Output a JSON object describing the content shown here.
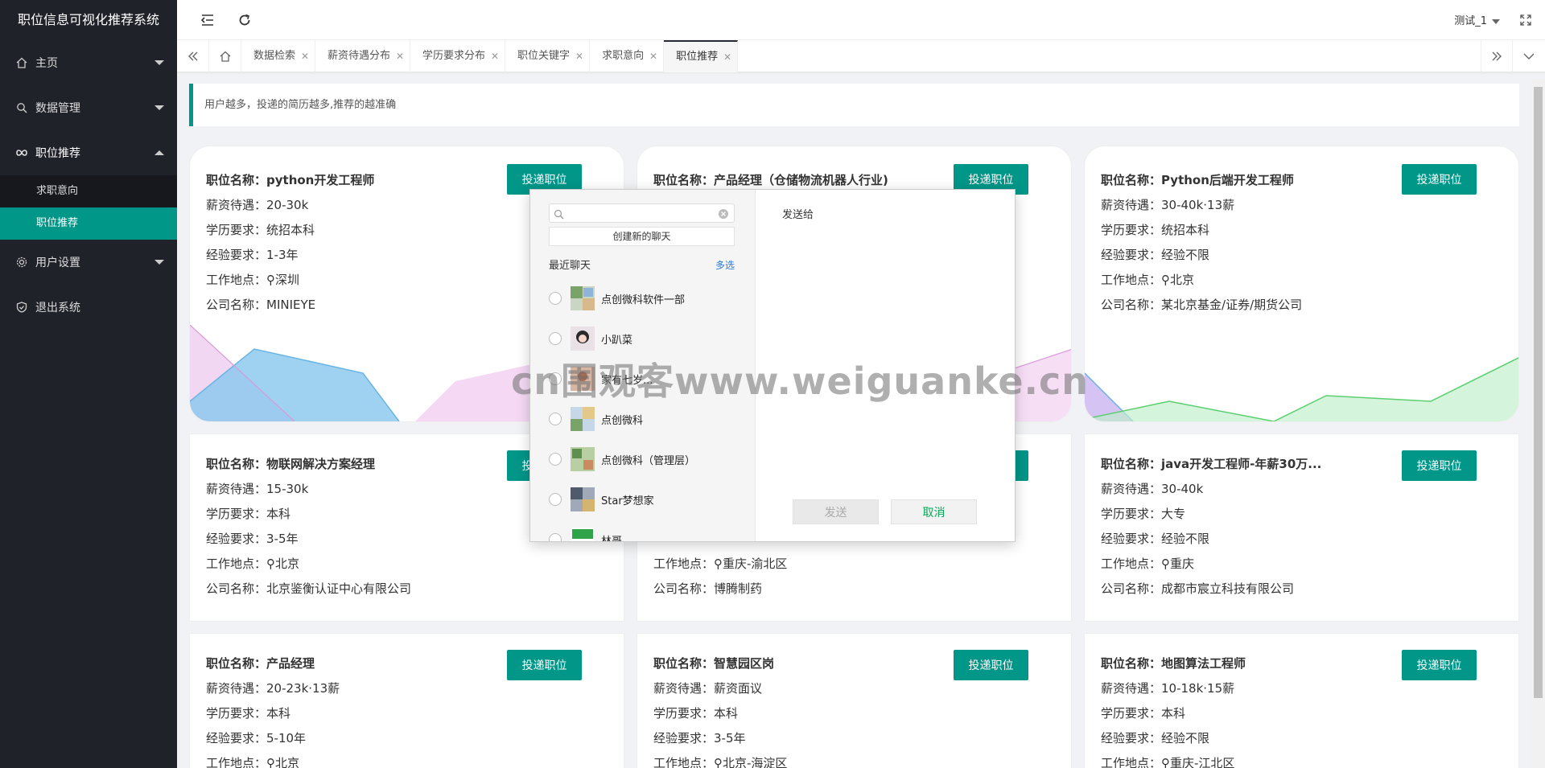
{
  "app": {
    "title": "职位信息可视化推荐系统"
  },
  "sidebar": {
    "items": [
      {
        "label": "主页"
      },
      {
        "label": "数据管理"
      },
      {
        "label": "职位推荐",
        "children": [
          {
            "label": "求职意向"
          },
          {
            "label": "职位推荐"
          }
        ]
      },
      {
        "label": "用户设置"
      },
      {
        "label": "退出系统"
      }
    ]
  },
  "header": {
    "user": "测试_1"
  },
  "tabs": [
    {
      "label": "数据检索"
    },
    {
      "label": "薪资待遇分布"
    },
    {
      "label": "学历要求分布"
    },
    {
      "label": "职位关键字"
    },
    {
      "label": "求职意向"
    },
    {
      "label": "职位推荐",
      "active": true
    }
  ],
  "notice": "用户越多，投递的简历越多,推荐的越准确",
  "apply_label": "投递职位",
  "field_labels": {
    "name": "职位名称：",
    "salary": "薪资待遇：",
    "edu": "学历要求：",
    "exp": "经验要求：",
    "loc": "工作地点：",
    "company": "公司名称："
  },
  "cards": [
    {
      "name": "python开发工程师",
      "salary": "20-30k",
      "edu": "统招本科",
      "exp": "1-3年",
      "loc": "深圳",
      "company": "MINIEYE"
    },
    {
      "name": "产品经理（仓储物流机器人行业)",
      "salary": "",
      "edu": "",
      "exp": "",
      "loc": "",
      "company": ""
    },
    {
      "name": "Python后端开发工程师",
      "salary": "30-40k·13薪",
      "edu": "统招本科",
      "exp": "经验不限",
      "loc": "北京",
      "company": "某北京基金/证券/期货公司"
    },
    {
      "name": "物联网解决方案经理",
      "salary": "15-30k",
      "edu": "本科",
      "exp": "3-5年",
      "loc": "北京",
      "company": "北京鉴衡认证中心有限公司"
    },
    {
      "name": "",
      "salary": "",
      "edu": "",
      "exp": "",
      "loc": "重庆-渝北区",
      "company": "博腾制药"
    },
    {
      "name": "java开发工程师-年薪30万...",
      "salary": "30-40k",
      "edu": "大专",
      "exp": "经验不限",
      "loc": "重庆",
      "company": "成都市宸立科技有限公司"
    },
    {
      "name": "产品经理",
      "salary": "20-23k·13薪",
      "edu": "本科",
      "exp": "5-10年",
      "loc": "北京",
      "company": ""
    },
    {
      "name": "智慧园区岗",
      "salary": "薪资面议",
      "edu": "本科",
      "exp": "3-5年",
      "loc": "北京-海淀区",
      "company": ""
    },
    {
      "name": "地图算法工程师",
      "salary": "10-18k·15薪",
      "edu": "本科",
      "exp": "经验不限",
      "loc": "重庆-江北区",
      "company": ""
    }
  ],
  "dialog": {
    "search_value": "",
    "new_chat": "创建新的聊天",
    "recent": "最近聊天",
    "multi": "多选",
    "contacts": [
      {
        "name": "点创微科软件一部"
      },
      {
        "name": "小趴菜"
      },
      {
        "name": "家有七岁..."
      },
      {
        "name": "点创微科"
      },
      {
        "name": "点创微科（管理层）"
      },
      {
        "name": "Star梦想家"
      },
      {
        "name": "林哥"
      }
    ],
    "send_to": "发送给",
    "send": "发送",
    "cancel": "取消"
  },
  "watermark": "cn围观客www.weiguanke.cn",
  "colors": {
    "accent": "#009688",
    "sidebar": "#20222a",
    "wechat_green": "#07a858"
  }
}
